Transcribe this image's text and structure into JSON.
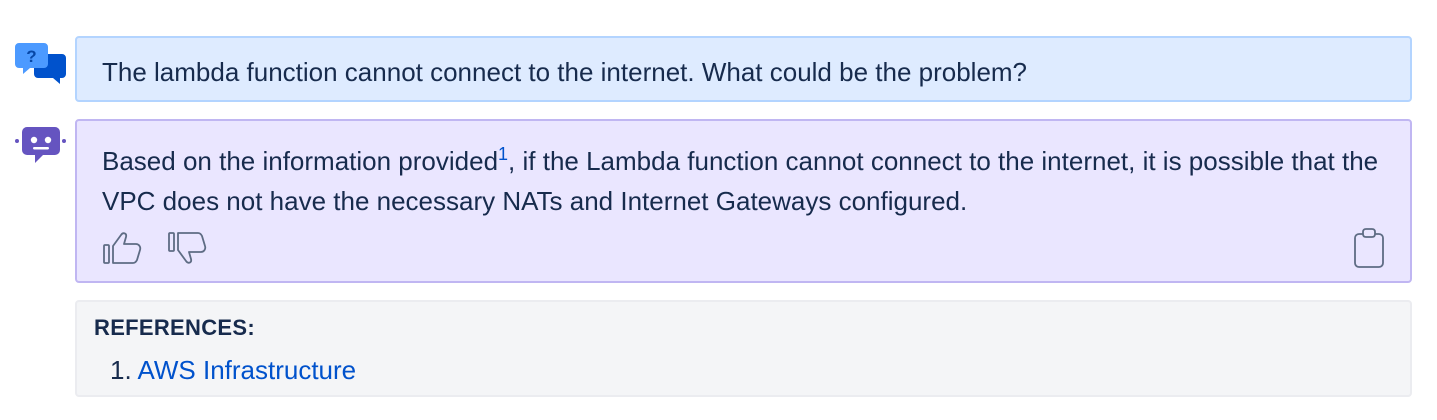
{
  "chat": {
    "question": {
      "text": "The lambda function cannot connect to the internet. What could be the problem?",
      "avatar_icon": "question-chat-icon"
    },
    "answer": {
      "text_before_citation": "Based on the information provided",
      "citation_marker": "1",
      "text_after_citation": ", if the Lambda function cannot connect to the internet, it is possible that the VPC does not have the necessary NATs and Internet Gateways configured.",
      "avatar_icon": "bot-icon",
      "actions": {
        "thumbs_up_icon": "thumbs-up-icon",
        "thumbs_down_icon": "thumbs-down-icon",
        "copy_icon": "clipboard-icon"
      }
    },
    "references": {
      "title": "REFERENCES:",
      "items": [
        {
          "number": "1.",
          "label": "AWS Infrastructure"
        }
      ]
    }
  },
  "colors": {
    "question_bg": "#DEEBFF",
    "question_border": "#B3D4FF",
    "answer_bg": "#EAE6FF",
    "answer_border": "#C0B6F2",
    "link": "#0052CC",
    "bot_purple": "#6554C0",
    "question_icon_blue": "#0052CC",
    "question_icon_light": "#4C9AFF"
  }
}
